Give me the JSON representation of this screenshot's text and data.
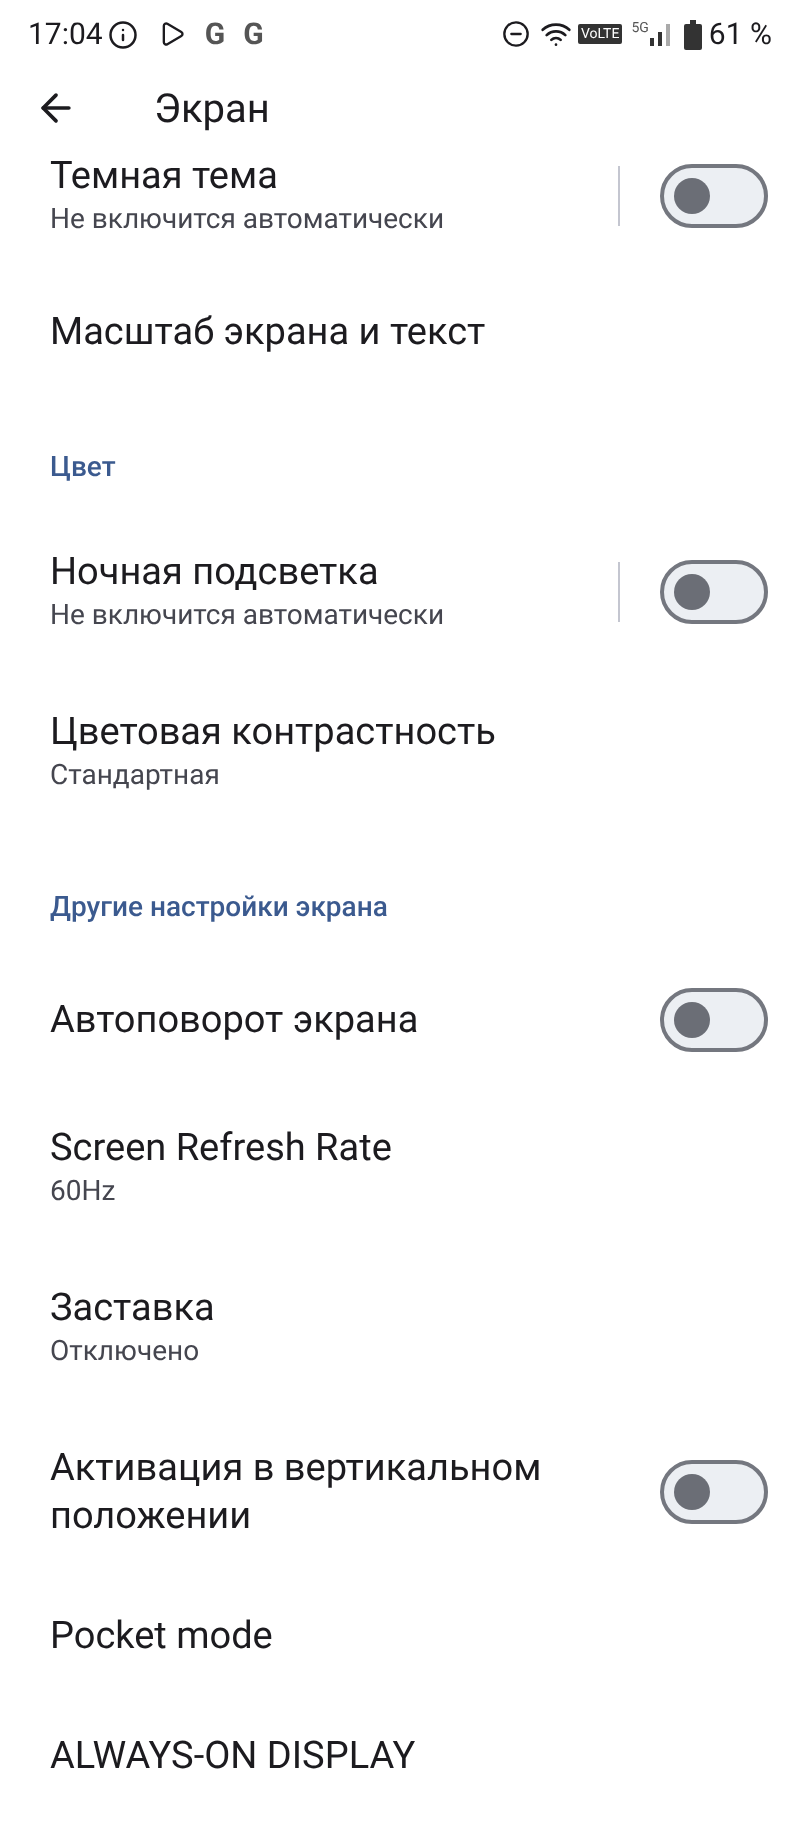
{
  "status_bar": {
    "time": "17:04",
    "notification_glyphs": [
      "G",
      "G"
    ],
    "volte": "VoLTE",
    "network": "5G",
    "battery": "61 %"
  },
  "header": {
    "title": "Экран"
  },
  "items": [
    {
      "kind": "switch",
      "title": "Темная тема",
      "subtitle": "Не включится автоматически",
      "on": false,
      "divider": true
    },
    {
      "kind": "plain",
      "title": "Масштаб экрана и текст"
    },
    {
      "kind": "section",
      "title": "Цвет"
    },
    {
      "kind": "switch",
      "title": "Ночная подсветка",
      "subtitle": "Не включится автоматически",
      "on": false,
      "divider": true
    },
    {
      "kind": "plain",
      "title": "Цветовая контрастность",
      "subtitle": "Стандартная"
    },
    {
      "kind": "section",
      "title": "Другие настройки экрана"
    },
    {
      "kind": "switch",
      "title": "Автоповорот экрана",
      "on": false,
      "divider": false
    },
    {
      "kind": "plain",
      "title": "Screen Refresh Rate",
      "subtitle": "60Hz"
    },
    {
      "kind": "plain",
      "title": "Заставка",
      "subtitle": "Отключено"
    },
    {
      "kind": "switch",
      "title": "Активация в вертикальном положении",
      "on": false,
      "divider": false
    },
    {
      "kind": "plain",
      "title": "Pocket mode"
    },
    {
      "kind": "plain",
      "title": "ALWAYS-ON DISPLAY"
    }
  ]
}
